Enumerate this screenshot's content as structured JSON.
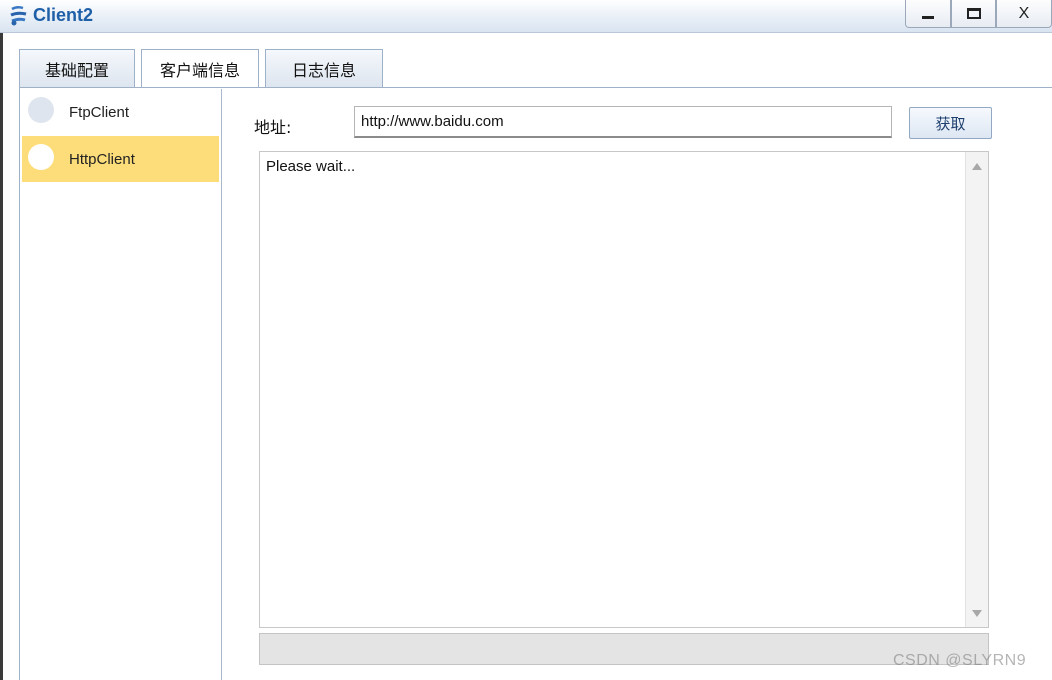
{
  "window": {
    "title": "Client2",
    "controls": {
      "minimize": "_",
      "maximize": "□",
      "close": "X"
    },
    "icon": "client-app-icon"
  },
  "tabs": [
    {
      "label": "基础配置",
      "active": false
    },
    {
      "label": "客户端信息",
      "active": true
    },
    {
      "label": "日志信息",
      "active": false
    }
  ],
  "sidebar": {
    "items": [
      {
        "label": "FtpClient",
        "selected": false
      },
      {
        "label": "HttpClient",
        "selected": true
      }
    ],
    "selected_color": "#fddd7a"
  },
  "http_panel": {
    "address_label": "地址:",
    "address_value": "http://www.baidu.com",
    "fetch_label": "获取",
    "output_text": "Please wait..."
  },
  "watermark": "CSDN @SLYRN9",
  "colors": {
    "title_text": "#1f5fa8",
    "accent_selected": "#fddd7a"
  }
}
